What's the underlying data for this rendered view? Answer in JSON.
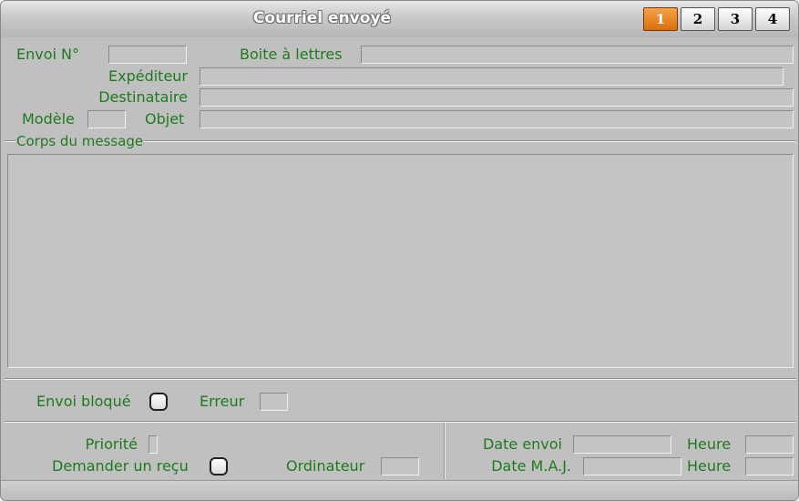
{
  "window": {
    "title": "Courriel envoyé",
    "tabs": [
      "1",
      "2",
      "3",
      "4"
    ],
    "active_tab": "1"
  },
  "form": {
    "envoi_no_label": "Envoi N°",
    "boite_label": "Boite à lettres",
    "expediteur_label": "Expéditeur",
    "destinataire_label": "Destinataire",
    "modele_label": "Modèle",
    "objet_label": "Objet",
    "corps_label": "Corps du message",
    "envoi_bloque_label": "Envoi bloqué",
    "erreur_label": "Erreur",
    "priorite_label": "Priorité",
    "demander_recu_label": "Demander un reçu",
    "ordinateur_label": "Ordinateur",
    "date_envoi_label": "Date envoi",
    "heure_envoi_label": "Heure",
    "date_maj_label": "Date M.A.J.",
    "heure_maj_label": "Heure"
  },
  "colors": {
    "label": "#1f7a1f",
    "active_tab": "#e07810",
    "background": "#c0c0c0"
  }
}
